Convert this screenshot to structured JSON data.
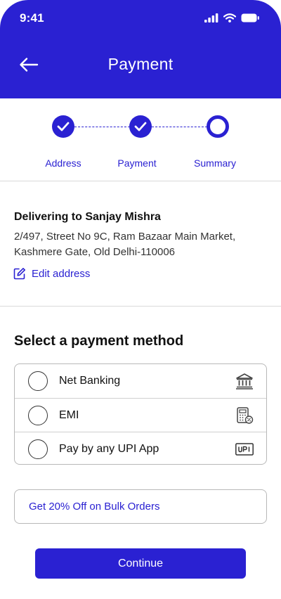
{
  "status_bar": {
    "time": "9:41"
  },
  "header": {
    "title": "Payment"
  },
  "stepper": {
    "steps": [
      {
        "label": "Address",
        "state": "completed"
      },
      {
        "label": "Payment",
        "state": "completed"
      },
      {
        "label": "Summary",
        "state": "current"
      }
    ]
  },
  "address": {
    "heading": "Delivering to Sanjay Mishra",
    "line1": "2/497, Street No 9C, Ram Bazaar Main Market,",
    "line2": "Kashmere Gate, Old Delhi-110006",
    "edit_label": "Edit address"
  },
  "payment": {
    "heading": "Select a payment method",
    "methods": [
      {
        "label": "Net Banking",
        "icon": "bank-icon",
        "selected": false
      },
      {
        "label": "EMI",
        "icon": "emi-calculator-icon",
        "selected": false
      },
      {
        "label": "Pay by any UPI App",
        "icon": "upi-icon",
        "selected": false
      }
    ]
  },
  "offer": {
    "label": "Get 20% Off on Bulk Orders"
  },
  "continue_label": "Continue",
  "colors": {
    "accent": "#2a21d2",
    "border": "#b8b8b8",
    "divider": "#d9d9d9"
  }
}
